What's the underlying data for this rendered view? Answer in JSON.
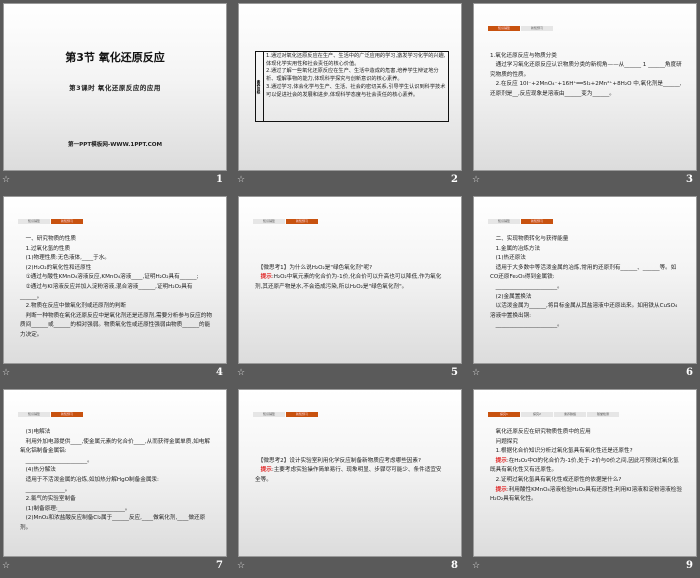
{
  "slides": [
    {
      "number": "1",
      "title": "第3节  氧化还原反应",
      "subtitle": "第3课时    氧化还原反应的应用",
      "footer": "第一PPT模板网-WWW.1PPT.COM"
    },
    {
      "number": "2",
      "box_label": "素养目标",
      "box_lines": [
        "1.通过对氧化还原反应在生产、生活中的广泛应用的学习,激发学习化学的兴趣,体现化学实用性和社会责任的核心价值。",
        "2.通过了解一些氧化还原反应在生产、生活中造成的危害,培养学生辩证地分析、理解事物的能力,体现科学探究与创新意识的核心素养。",
        "3.通过学习,体会化学与生产、生活、社会的密切关系,引导学生认识到科学技术可以促进社会的发展和进步,体现科学态度与社会责任的核心素养。"
      ]
    },
    {
      "number": "3",
      "tabs": [
        {
          "label": "知识铺垫",
          "active": true
        },
        {
          "label": "新知预习",
          "active": false
        }
      ],
      "lines": [
        "",
        "1.氧化还原反应与物质分类",
        "　通过学习氧化还原反应认识物质分类的新视角——从______ 1 ______角度研究物质的性质。",
        "　2.在反应 10I⁻+2MnO₄⁻+16H⁺══5I₂+2Mn²⁺+8H₂O 中,氧化剂是______,还原剂是__,反应现象是溶液由______变为______。"
      ]
    },
    {
      "number": "4",
      "tabs": [
        {
          "label": "知识铺垫",
          "active": false
        },
        {
          "label": "新知预习",
          "active": true
        }
      ],
      "lines": [
        "　一、研究物质的性质",
        "　1.过氧化氢的性质",
        "　(1)物理性质:无色液体,____于水。",
        "　(2)H₂O₂的氧化性和还原性",
        "　①通过与酸性KMnO₄溶液反应,KMnO₄溶液____,证明H₂O₂具有______;",
        "　②通过与KI溶液反应并加入淀粉溶液,混合溶液______,证明H₂O₂具有______。",
        "　2.物质在反应中做氧化剂或还原剂的判断",
        "　判断一种物质在氧化还原反应中是氧化剂还是还原剂,需要分析参与反应的物质间______或______的相对强弱。物质氧化性或还原性强弱由物质______的能力决定。"
      ]
    },
    {
      "number": "5",
      "tabs": [
        {
          "label": "知识铺垫",
          "active": false
        },
        {
          "label": "新知预习",
          "active": true
        }
      ],
      "lines": [
        "",
        "",
        "",
        "　【微思考1】为什么说H₂O₂是\"绿色氧化剂\"呢?",
        "　提示:H₂O₂中氧元素的化合价为-1价,化合价可以升高也可以降低,作为氧化剂,其还原产物是水,不会造成污染,所以H₂O₂是\"绿色氧化剂\"。"
      ]
    },
    {
      "number": "6",
      "tabs": [
        {
          "label": "知识铺垫",
          "active": false
        },
        {
          "label": "新知预习",
          "active": true
        }
      ],
      "lines": [
        "　二、实现物质转化与获得能量",
        "　1.金属的冶炼方法",
        "　(1)热还原法",
        "　适用于大多数中等活泼金属的冶炼,常用的还原剂有______、______等。如CO还原Fe₂O₃得到金属铁:",
        "　______________________。",
        "　(2)金属置换法",
        "　以活泼金属为______,将目标金属从其盐溶液中还原出来。如用铁从CuSO₄溶液中置换出铜:",
        "　______________________。"
      ]
    },
    {
      "number": "7",
      "tabs": [
        {
          "label": "知识铺垫",
          "active": false
        },
        {
          "label": "新知预习",
          "active": true
        }
      ],
      "lines": [
        "　(3)电解法",
        "　利用外加电源提供____,使金属元素的化合价____,从而获得金属单质,如电解氧化铝制备金属铝:",
        "　______________________。",
        "　(4)热分解法",
        "　适用于不活泼金属的冶炼,如加热分解HgO制备金属汞:",
        "　______________。",
        "　2.氯气的实验室制备",
        "　(1)制备原理:________________________。",
        "　(2)MnO₂和浓盐酸反应制备Cl₂属于______反应,____做氧化剂,____做还原剂。"
      ]
    },
    {
      "number": "8",
      "tabs": [
        {
          "label": "知识铺垫",
          "active": false
        },
        {
          "label": "新知预习",
          "active": true
        }
      ],
      "lines": [
        "",
        "",
        "",
        "　【微思考2】设计实验室利用化学反应制备新物质应考虑哪些因素?",
        "　提示:主要考虑实验操作简单易行、现象明显、步骤尽可能少、条件适宜安全等。"
      ]
    },
    {
      "number": "9",
      "tabs": [
        {
          "label": "探究1",
          "active": true
        },
        {
          "label": "探究2",
          "active": false
        },
        {
          "label": "素养脉络",
          "active": false
        },
        {
          "label": "随堂检测",
          "active": false
        }
      ],
      "lines": [
        "　氧化还原反应在研究物质性质中的应用",
        "　问题探究",
        "　1.根据化合价知识分析过氧化氢具有氧化性还是还原性?",
        "　提示:在H₂O₂中O的化合价为-1价,处于-2价与0价之间,因此可预测过氧化氢既具有氧化性又有还原性。",
        "　2.证明过氧化氢具有氧化性或还原性的依据是什么?",
        "　提示:利用酸性KMnO₄溶液检验H₂O₂具有还原性;利用KI溶液和淀粉溶液检验H₂O₂具有氧化性。"
      ]
    }
  ],
  "hint_word": "提示",
  "star_icon": "☆",
  "colors": {
    "accent": "#c8520f",
    "hint": "#e02020",
    "background": "#5a5a5a"
  }
}
